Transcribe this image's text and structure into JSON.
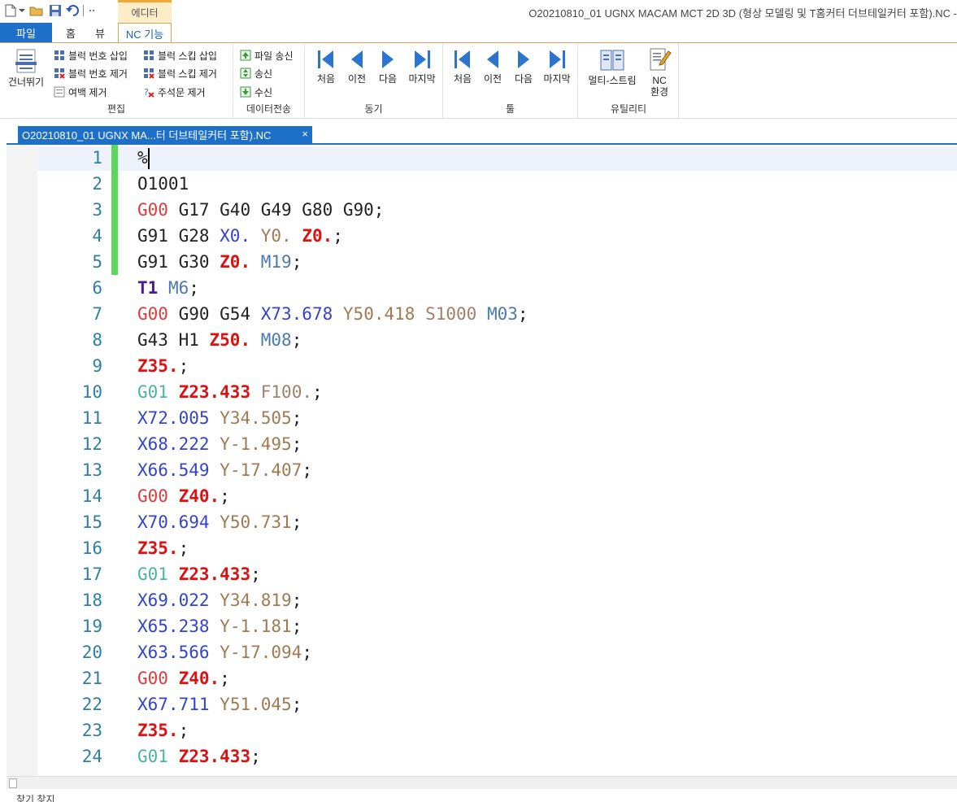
{
  "window": {
    "title": "O20210810_01 UGNX MACAM MCT 2D 3D (형상 모델링 및 T홈커터 더브테일커터 포함).NC -",
    "context_tab": "에디터"
  },
  "tabs": [
    "파일",
    "홈",
    "뷰",
    "NC 기능"
  ],
  "ribbon": {
    "edit": {
      "label": "편집",
      "skip_label": "건너뛰기",
      "items": [
        "블럭 번호 삽입",
        "블럭 번호 제거",
        "여백 제거",
        "블럭 스킵 삽입",
        "블럭 스킵 제거",
        "주석문 제거"
      ]
    },
    "data": {
      "label": "데이터전송",
      "items": [
        "파일 송신",
        "송신",
        "수신"
      ]
    },
    "sync": {
      "label": "동기",
      "items": [
        "처음",
        "이전",
        "다음",
        "마지막"
      ]
    },
    "tool": {
      "label": "툴",
      "items": [
        "처음",
        "이전",
        "다음",
        "마지막"
      ]
    },
    "utility": {
      "label": "유틸리티",
      "multistream": "멀티-스트림",
      "nc_env_1": "NC",
      "nc_env_2": "환경"
    }
  },
  "document_tab": {
    "title": "O20210810_01 UGNX MA...터 더브테일커터 포함).NC",
    "close": "×"
  },
  "colors": {
    "g00": "#e03a3a",
    "g01": "#4db3a8",
    "x": "#3344cc",
    "y": "#a07a50",
    "z": "#dd1111",
    "t": "#4a1a90",
    "m": "#4a7ab0",
    "s": "#a0806a",
    "default": "#222222"
  },
  "code_lines": [
    {
      "num": "1",
      "marked": true,
      "tokens": [
        {
          "t": "%",
          "c": "default"
        }
      ]
    },
    {
      "num": "2",
      "marked": true,
      "tokens": [
        {
          "t": "O1001",
          "c": "default"
        }
      ]
    },
    {
      "num": "3",
      "marked": true,
      "tokens": [
        {
          "t": "G00",
          "c": "g00"
        },
        {
          "t": " G17 G40 G49 G80 G90;",
          "c": "default"
        }
      ]
    },
    {
      "num": "4",
      "marked": true,
      "tokens": [
        {
          "t": "G91 G28 ",
          "c": "default"
        },
        {
          "t": "X0.",
          "c": "x"
        },
        {
          "t": " ",
          "c": "default"
        },
        {
          "t": "Y0.",
          "c": "y"
        },
        {
          "t": " ",
          "c": "default"
        },
        {
          "t": "Z0.",
          "c": "z",
          "b": true
        },
        {
          "t": ";",
          "c": "default"
        }
      ]
    },
    {
      "num": "5",
      "marked": true,
      "tokens": [
        {
          "t": "G91 G30 ",
          "c": "default"
        },
        {
          "t": "Z0.",
          "c": "z",
          "b": true
        },
        {
          "t": " ",
          "c": "default"
        },
        {
          "t": "M19",
          "c": "m"
        },
        {
          "t": ";",
          "c": "default"
        }
      ]
    },
    {
      "num": "6",
      "marked": false,
      "tokens": [
        {
          "t": "T1",
          "c": "t",
          "b": true
        },
        {
          "t": " ",
          "c": "default"
        },
        {
          "t": "M6",
          "c": "m"
        },
        {
          "t": ";",
          "c": "default"
        }
      ]
    },
    {
      "num": "7",
      "marked": false,
      "tokens": [
        {
          "t": "G00",
          "c": "g00"
        },
        {
          "t": " G90 G54 ",
          "c": "default"
        },
        {
          "t": "X73.678",
          "c": "x"
        },
        {
          "t": " ",
          "c": "default"
        },
        {
          "t": "Y50.418",
          "c": "y"
        },
        {
          "t": " ",
          "c": "default"
        },
        {
          "t": "S1000",
          "c": "s"
        },
        {
          "t": " ",
          "c": "default"
        },
        {
          "t": "M03",
          "c": "m"
        },
        {
          "t": ";",
          "c": "default"
        }
      ]
    },
    {
      "num": "8",
      "marked": false,
      "tokens": [
        {
          "t": "G43 H1 ",
          "c": "default"
        },
        {
          "t": "Z50.",
          "c": "z",
          "b": true
        },
        {
          "t": " ",
          "c": "default"
        },
        {
          "t": "M08",
          "c": "m"
        },
        {
          "t": ";",
          "c": "default"
        }
      ]
    },
    {
      "num": "9",
      "marked": false,
      "tokens": [
        {
          "t": "Z35.",
          "c": "z",
          "b": true
        },
        {
          "t": ";",
          "c": "default"
        }
      ]
    },
    {
      "num": "10",
      "marked": false,
      "tokens": [
        {
          "t": "G01",
          "c": "g01"
        },
        {
          "t": " ",
          "c": "default"
        },
        {
          "t": "Z23.433",
          "c": "z",
          "b": true
        },
        {
          "t": " ",
          "c": "default"
        },
        {
          "t": "F100.",
          "c": "s"
        },
        {
          "t": ";",
          "c": "default"
        }
      ]
    },
    {
      "num": "11",
      "marked": false,
      "tokens": [
        {
          "t": "X72.005",
          "c": "x"
        },
        {
          "t": " ",
          "c": "default"
        },
        {
          "t": "Y34.505",
          "c": "y"
        },
        {
          "t": ";",
          "c": "default"
        }
      ]
    },
    {
      "num": "12",
      "marked": false,
      "tokens": [
        {
          "t": "X68.222",
          "c": "x"
        },
        {
          "t": " ",
          "c": "default"
        },
        {
          "t": "Y-1.495",
          "c": "y"
        },
        {
          "t": ";",
          "c": "default"
        }
      ]
    },
    {
      "num": "13",
      "marked": false,
      "tokens": [
        {
          "t": "X66.549",
          "c": "x"
        },
        {
          "t": " ",
          "c": "default"
        },
        {
          "t": "Y-17.407",
          "c": "y"
        },
        {
          "t": ";",
          "c": "default"
        }
      ]
    },
    {
      "num": "14",
      "marked": false,
      "tokens": [
        {
          "t": "G00",
          "c": "g00"
        },
        {
          "t": " ",
          "c": "default"
        },
        {
          "t": "Z40.",
          "c": "z",
          "b": true
        },
        {
          "t": ";",
          "c": "default"
        }
      ]
    },
    {
      "num": "15",
      "marked": false,
      "tokens": [
        {
          "t": "X70.694",
          "c": "x"
        },
        {
          "t": " ",
          "c": "default"
        },
        {
          "t": "Y50.731",
          "c": "y"
        },
        {
          "t": ";",
          "c": "default"
        }
      ]
    },
    {
      "num": "16",
      "marked": false,
      "tokens": [
        {
          "t": "Z35.",
          "c": "z",
          "b": true
        },
        {
          "t": ";",
          "c": "default"
        }
      ]
    },
    {
      "num": "17",
      "marked": false,
      "tokens": [
        {
          "t": "G01",
          "c": "g01"
        },
        {
          "t": " ",
          "c": "default"
        },
        {
          "t": "Z23.433",
          "c": "z",
          "b": true
        },
        {
          "t": ";",
          "c": "default"
        }
      ]
    },
    {
      "num": "18",
      "marked": false,
      "tokens": [
        {
          "t": "X69.022",
          "c": "x"
        },
        {
          "t": " ",
          "c": "default"
        },
        {
          "t": "Y34.819",
          "c": "y"
        },
        {
          "t": ";",
          "c": "default"
        }
      ]
    },
    {
      "num": "19",
      "marked": false,
      "tokens": [
        {
          "t": "X65.238",
          "c": "x"
        },
        {
          "t": " ",
          "c": "default"
        },
        {
          "t": "Y-1.181",
          "c": "y"
        },
        {
          "t": ";",
          "c": "default"
        }
      ]
    },
    {
      "num": "20",
      "marked": false,
      "tokens": [
        {
          "t": "X63.566",
          "c": "x"
        },
        {
          "t": " ",
          "c": "default"
        },
        {
          "t": "Y-17.094",
          "c": "y"
        },
        {
          "t": ";",
          "c": "default"
        }
      ]
    },
    {
      "num": "21",
      "marked": false,
      "tokens": [
        {
          "t": "G00",
          "c": "g00"
        },
        {
          "t": " ",
          "c": "default"
        },
        {
          "t": "Z40.",
          "c": "z",
          "b": true
        },
        {
          "t": ";",
          "c": "default"
        }
      ]
    },
    {
      "num": "22",
      "marked": false,
      "tokens": [
        {
          "t": "X67.711",
          "c": "x"
        },
        {
          "t": " ",
          "c": "default"
        },
        {
          "t": "Y51.045",
          "c": "y"
        },
        {
          "t": ";",
          "c": "default"
        }
      ]
    },
    {
      "num": "23",
      "marked": false,
      "tokens": [
        {
          "t": "Z35.",
          "c": "z",
          "b": true
        },
        {
          "t": ";",
          "c": "default"
        }
      ]
    },
    {
      "num": "24",
      "marked": false,
      "tokens": [
        {
          "t": "G01",
          "c": "g01"
        },
        {
          "t": " ",
          "c": "default"
        },
        {
          "t": "Z23.433",
          "c": "z",
          "b": true
        },
        {
          "t": ";",
          "c": "default"
        }
      ]
    }
  ],
  "status": {
    "text": "찾기 찾지"
  }
}
